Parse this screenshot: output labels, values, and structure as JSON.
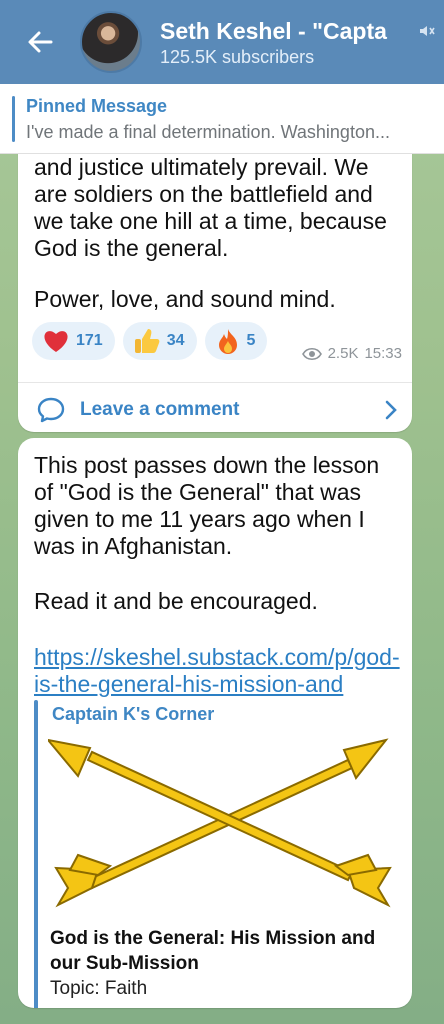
{
  "header": {
    "channel_title": "Seth Keshel - \"Capta",
    "subscribers": "125.5K subscribers"
  },
  "pinned": {
    "title": "Pinned Message",
    "text": "I've made a final determination.  Washington..."
  },
  "post1": {
    "text": "and justice ultimately prevail.  We are soldiers on the battlefield and we take one hill at a time, because God is the general.",
    "text2": "Power, love, and sound mind.",
    "reactions": [
      {
        "emoji": "heart",
        "count": "171"
      },
      {
        "emoji": "thumbs-up",
        "count": "34"
      },
      {
        "emoji": "fire",
        "count": "5"
      }
    ],
    "views": "2.5K",
    "time": "15:33",
    "comment_label": "Leave a comment"
  },
  "post2": {
    "text": "This post passes down the lesson of \"God is the General\" that was given to me 11 years ago when I was in Afghanistan.",
    "text2": "Read it and be encouraged.",
    "link": "https://skeshel.substack.com/p/god-is-the-general-his-mission-and",
    "preview": {
      "site": "Captain K's Corner",
      "title": "God is the General: His Mission and our Sub-Mission",
      "description": "Topic: Faith"
    }
  },
  "colors": {
    "header_bg": "#5a8ab8",
    "accent": "#3a84c5",
    "reaction_bg": "#e7f1fa"
  }
}
